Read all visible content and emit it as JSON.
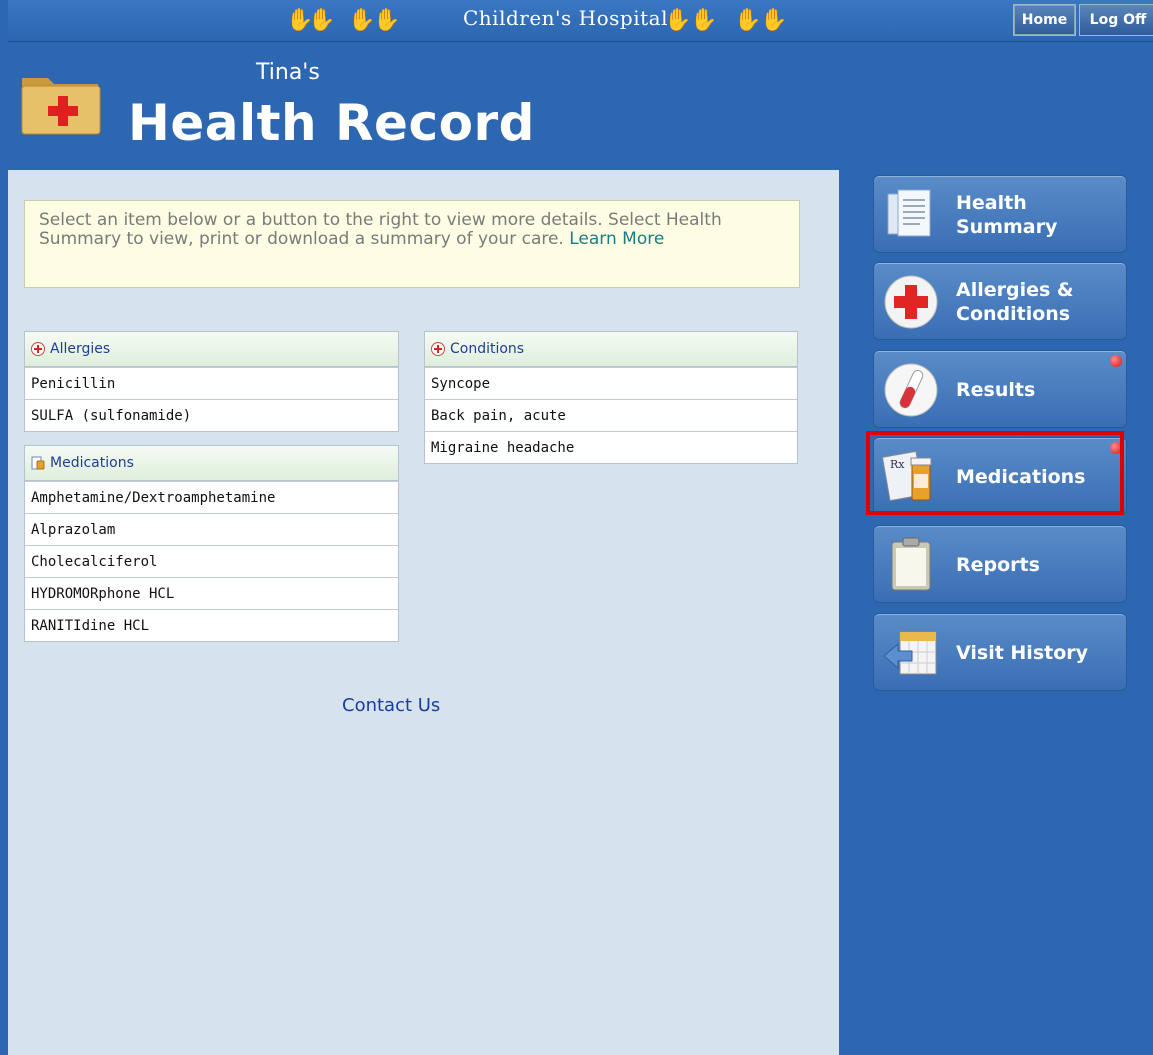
{
  "topbar": {
    "hospital_name": "Children's Hospital",
    "home_label": "Home",
    "logoff_label": "Log Off"
  },
  "header": {
    "owner": "Tina's",
    "title": "Health Record"
  },
  "info": {
    "text": "Select an item below or a button to the right to view more details. Select Health Summary to view, print or download a summary of your care. ",
    "link": "Learn More"
  },
  "allergies": {
    "title": "Allergies",
    "items": [
      "Penicillin",
      "SULFA (sulfonamide)"
    ]
  },
  "medications": {
    "title": "Medications",
    "items": [
      "Amphetamine/Dextroamphetamine",
      "Alprazolam",
      "Cholecalciferol",
      "HYDROMORphone HCL",
      "RANITIdine HCL"
    ]
  },
  "conditions": {
    "title": "Conditions",
    "items": [
      "Syncope",
      "Back pain, acute",
      "Migraine headache"
    ]
  },
  "footer": {
    "contact": "Contact Us"
  },
  "nav": {
    "health_summary": [
      "Health",
      "Summary"
    ],
    "allergies_conditions": [
      "Allergies &",
      "Conditions"
    ],
    "results": "Results",
    "medications": "Medications",
    "reports": "Reports",
    "visit_history": "Visit History"
  },
  "colors": {
    "accent": "#2e67b1",
    "highlight": "#e00000",
    "panel": "#d6e3ed"
  }
}
